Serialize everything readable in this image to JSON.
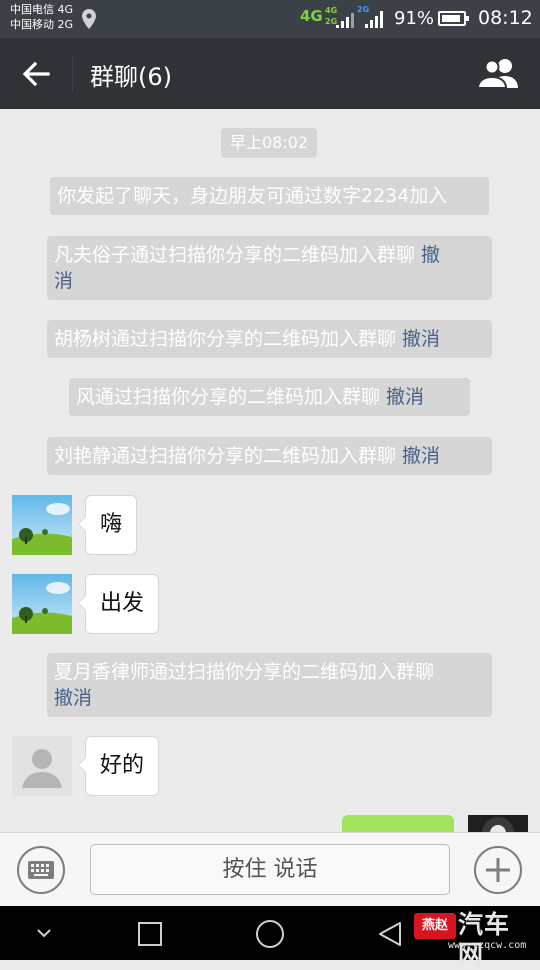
{
  "status_bar": {
    "carrier_1": "中国电信 4G",
    "carrier_2": "中国移动 2G",
    "network_main": "4G",
    "network_small_1": "4G",
    "network_small_2": "2G",
    "network_2g": "2G",
    "battery_percent": "91%",
    "battery_level": 0.91,
    "time": "08:12",
    "icons": [
      "location-icon",
      "signal-icon",
      "battery-icon"
    ]
  },
  "header": {
    "title": "群聊(6)",
    "back_icon": "arrow-left-icon",
    "members_icon": "group-icon"
  },
  "messages": {
    "timestamp": "早上08:02",
    "system": [
      {
        "text": "你发起了聊天，身边朋友可通过数字2234加入",
        "link": ""
      },
      {
        "text": "凡夫俗子通过扫描你分享的二维码加入群聊 ",
        "link": "撤"
      },
      {
        "text": "胡杨树通过扫描你分享的二维码加入群聊 ",
        "link": "撤消"
      },
      {
        "text": "风通过扫描你分享的二维码加入群聊 ",
        "link": "撤消"
      },
      {
        "text": "刘艳静通过扫描你分享的二维码加入群聊 ",
        "link": "撤消"
      },
      {
        "text": "夏月香律师通过扫描你分享的二维码加入群聊",
        "link": ""
      }
    ],
    "system_wrap_1": "消",
    "system_wrap_6": "撤消",
    "chat": [
      {
        "text": "嗨",
        "avatar": "landscape-avatar"
      },
      {
        "text": "出发",
        "avatar": "landscape-avatar"
      },
      {
        "text": "好的",
        "avatar": "default-person-avatar"
      }
    ]
  },
  "input_bar": {
    "keyboard_icon": "keyboard-icon",
    "hold_to_talk": "按住 说话",
    "plus_icon": "plus-icon"
  },
  "nav_bar": {
    "icons": [
      "chevron-down-icon",
      "square-recents-icon",
      "circle-home-icon",
      "triangle-back-icon"
    ]
  },
  "watermark": {
    "brand": "汽车网",
    "url": "www.yzqcw.com",
    "badge": "燕赵"
  },
  "colors": {
    "status_bar_bg": "#3b4146",
    "title_bar_bg": "#2f3338",
    "chat_bg": "#ebebeb",
    "system_msg_bg": "#d6d6d6",
    "link_color": "#4a6189",
    "sent_bubble": "#a2e35e",
    "network_green": "#7fd23a"
  }
}
